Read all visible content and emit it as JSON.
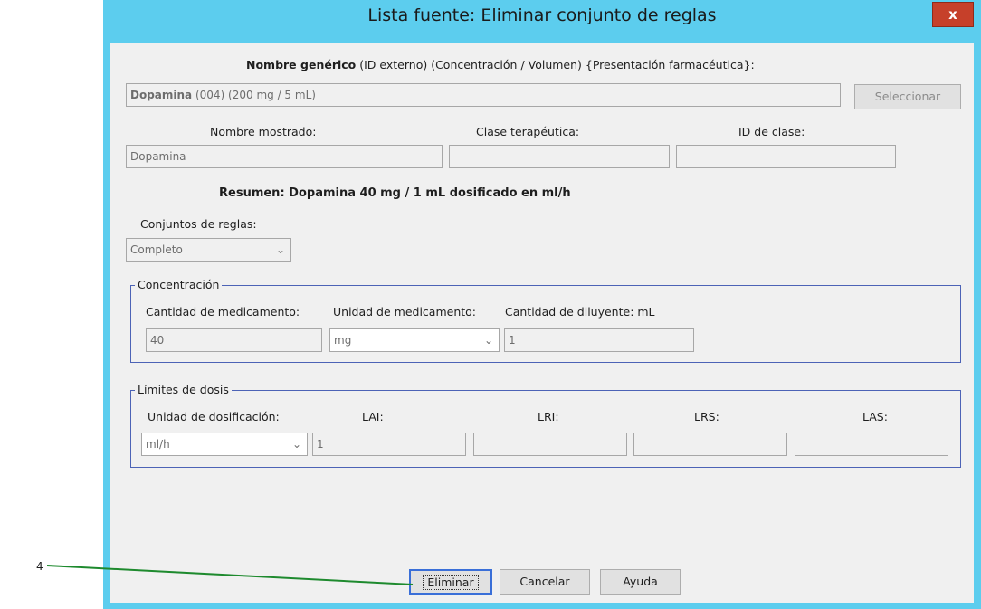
{
  "window": {
    "title": "Lista fuente: Eliminar conjunto de reglas",
    "close": "x"
  },
  "generic": {
    "header_bold": "Nombre genérico",
    "header_rest": " (ID externo) (Concentración / Volumen) {Presentación farmacéutica}:",
    "value_bold": "Dopamina",
    "value_rest": " (004) (200 mg / 5 mL)",
    "select_button": "Seleccionar"
  },
  "labels": {
    "display_name": "Nombre mostrado:",
    "therapeutic_class": "Clase terapéutica:",
    "class_id": "ID de clase:"
  },
  "fields": {
    "display_name": "Dopamina",
    "therapeutic_class": "",
    "class_id": ""
  },
  "summary": "Resumen: Dopamina 40 mg / 1 mL dosificado en ml/h",
  "rulesets": {
    "label": "Conjuntos de reglas:",
    "value": "Completo"
  },
  "concentration": {
    "title": "Concentración",
    "drug_amount_label": "Cantidad de medicamento:",
    "drug_unit_label": "Unidad de medicamento:",
    "diluent_label": "Cantidad de diluyente: mL",
    "drug_amount": "40",
    "drug_unit": "mg",
    "diluent": "1"
  },
  "dose_limits": {
    "title": "Límites de dosis",
    "unit_label": "Unidad de dosificación:",
    "lai_label": "LAI:",
    "lri_label": "LRI:",
    "lrs_label": "LRS:",
    "las_label": "LAS:",
    "unit": "ml/h",
    "lai": "1",
    "lri": "",
    "lrs": "",
    "las": ""
  },
  "buttons": {
    "delete": "Eliminar",
    "cancel": "Cancelar",
    "help": "Ayuda"
  },
  "callout": {
    "number": "4",
    "color": "#1e8a2e"
  },
  "icons": {
    "dropdown": "chevron-down-icon"
  }
}
